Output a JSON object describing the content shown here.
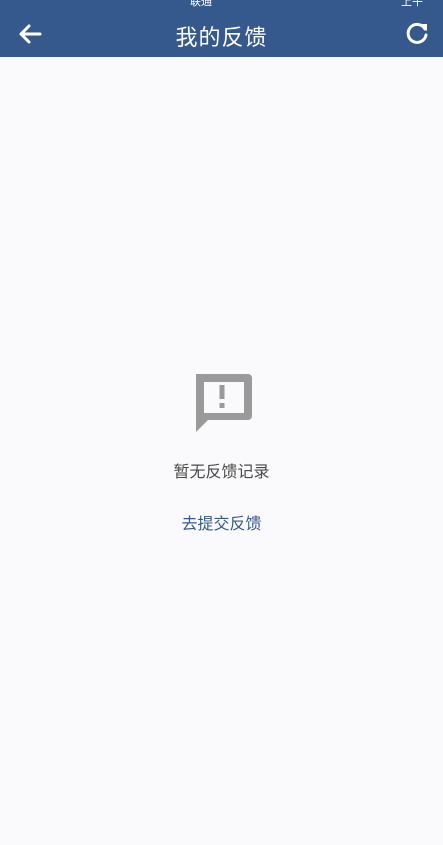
{
  "status_bar": {
    "carrier": "联通",
    "time": "上午"
  },
  "header": {
    "title": "我的反馈",
    "background_color": "#35598d",
    "back_icon": "arrow-left-icon",
    "refresh_icon": "refresh-icon"
  },
  "empty_state": {
    "icon": "comment-alert-icon",
    "message": "暂无反馈记录",
    "action_label": "去提交反馈"
  },
  "colors": {
    "accent": "#35598d",
    "background": "#fafafc",
    "icon_gray": "#9a9a9a",
    "text": "#4a4a4a"
  }
}
